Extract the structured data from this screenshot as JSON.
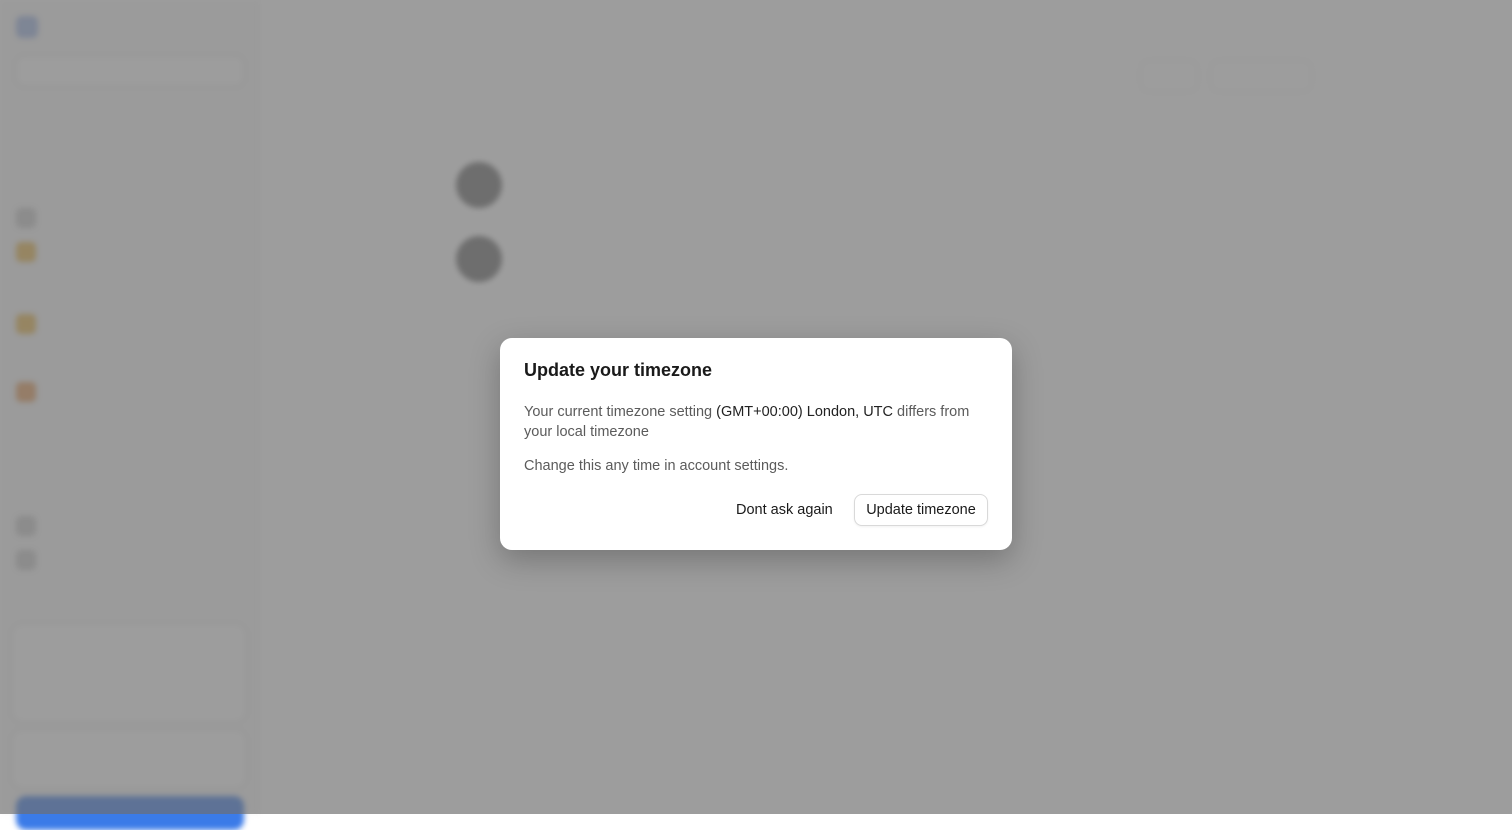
{
  "dialog": {
    "title": "Update your timezone",
    "body_prefix": "Your current timezone setting ",
    "current_timezone": "(GMT+00:00) London, UTC",
    "body_suffix": " differs from your local timezone",
    "note": "Change this any time in account settings.",
    "dont_ask_label": "Dont ask again",
    "update_label": "Update timezone"
  },
  "colors": {
    "overlay": "#8f8f8f",
    "dialog_bg": "#ffffff",
    "sidebar_cta": "#3b7be8",
    "accent_gold": "#e8b54a"
  },
  "icons": [
    "workspace-logo-icon",
    "sidebar-item-icon",
    "avatar"
  ]
}
